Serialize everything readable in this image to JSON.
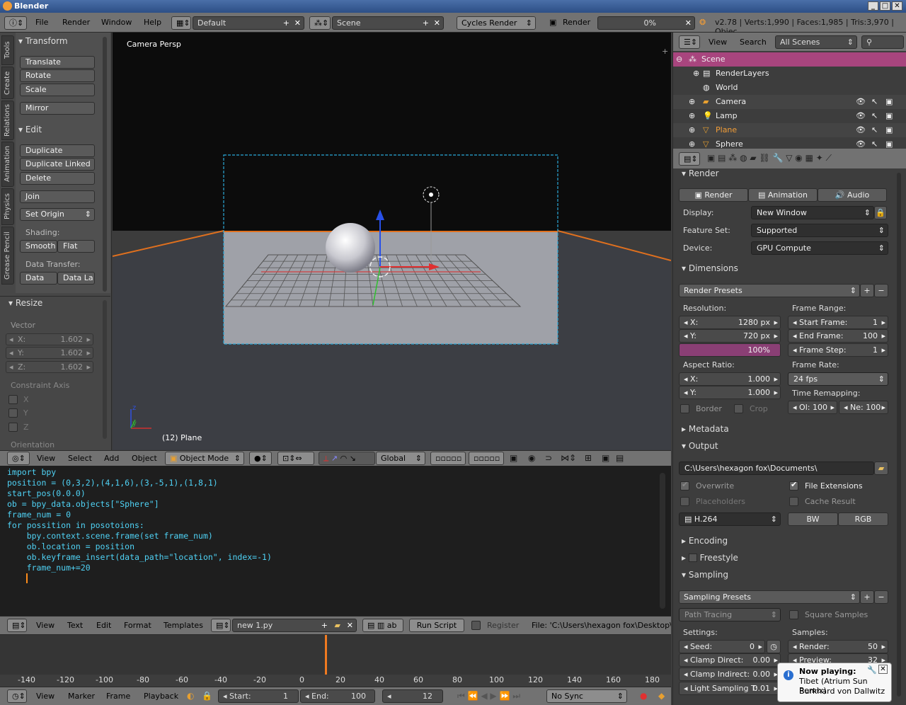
{
  "window": {
    "title": "Blender"
  },
  "info_header": {
    "menus": [
      "File",
      "Render",
      "Window",
      "Help"
    ],
    "layout": "Default",
    "scene": "Scene",
    "engine": "Cycles Render",
    "render_label": "Render",
    "progress": "0%",
    "stats": "v2.78 | Verts:1,990 | Faces:1,985 | Tris:3,970 | Objec"
  },
  "toolshelf": {
    "tabs": [
      "Tools",
      "Create",
      "Relations",
      "Animation",
      "Physics",
      "Grease Pencil"
    ],
    "transform_title": "Transform",
    "translate": "Translate",
    "rotate": "Rotate",
    "scale": "Scale",
    "mirror": "Mirror",
    "edit_title": "Edit",
    "duplicate": "Duplicate",
    "duplicate_linked": "Duplicate Linked",
    "delete": "Delete",
    "join": "Join",
    "set_origin": "Set Origin",
    "shading_label": "Shading:",
    "smooth": "Smooth",
    "flat": "Flat",
    "data_transfer_label": "Data Transfer:",
    "data": "Data",
    "data_la": "Data La",
    "resize_title": "Resize",
    "vector_label": "Vector",
    "vx": "X:",
    "vy": "Y:",
    "vz": "Z:",
    "vx_val": "1.602",
    "vy_val": "1.602",
    "vz_val": "1.602",
    "constraint_label": "Constraint Axis",
    "cx": "X",
    "cy": "Y",
    "cz": "Z",
    "orientation_label": "Orientation"
  },
  "viewport": {
    "view_label": "Camera Persp",
    "object_label": "(12) Plane",
    "axis_z": "z",
    "axis_y": "y"
  },
  "view_header": {
    "menus": [
      "View",
      "Select",
      "Add",
      "Object"
    ],
    "mode": "Object Mode",
    "orientation": "Global"
  },
  "text_editor": {
    "lines": [
      "import bpy",
      "position = (0,3,2),(4,1,6),(3,-5,1),(1,8,1)",
      "start_pos(0.0.0)",
      "ob = bpy_data.objects[\"Sphere\"]",
      "frame_num = 0",
      "for possition in posotoions:",
      "    bpy.context.scene.frame(set frame_num)",
      "    ob.location = position",
      "    ob.keyframe_insert(data_path=\"location\", index=-1)",
      "    frame_num+=20"
    ]
  },
  "text_header": {
    "menus": [
      "View",
      "Text",
      "Edit",
      "Format",
      "Templates"
    ],
    "file": "new 1.py",
    "run_script": "Run Script",
    "register": "Register",
    "path": "File: 'C:\\Users\\hexagon fox\\Desktop\\n"
  },
  "timeline": {
    "ticks": [
      "-140",
      "-120",
      "-100",
      "-80",
      "-60",
      "-40",
      "-20",
      "0",
      "20",
      "40",
      "60",
      "80",
      "100",
      "120",
      "140",
      "160",
      "180"
    ]
  },
  "timeline_header": {
    "menus": [
      "View",
      "Marker",
      "Frame",
      "Playback"
    ],
    "start_label": "Start:",
    "start": "1",
    "end_label": "End:",
    "end": "100",
    "current": "12",
    "sync": "No Sync"
  },
  "outliner": {
    "menus": [
      "View",
      "Search"
    ],
    "filter": "All Scenes",
    "rows": [
      {
        "name": "Scene"
      },
      {
        "name": "RenderLayers"
      },
      {
        "name": "World"
      },
      {
        "name": "Camera"
      },
      {
        "name": "Lamp"
      },
      {
        "name": "Plane"
      },
      {
        "name": "Sphere"
      }
    ]
  },
  "properties": {
    "render_title": "Render",
    "render_btn": "Render",
    "animation_btn": "Animation",
    "audio_btn": "Audio",
    "display_label": "Display:",
    "display": "New Window",
    "feature_label": "Feature Set:",
    "feature": "Supported",
    "device_label": "Device:",
    "device": "GPU Compute",
    "dimensions_title": "Dimensions",
    "render_presets": "Render Presets",
    "resolution_label": "Resolution:",
    "res_x": "X:",
    "res_x_val": "1280 px",
    "res_y": "Y:",
    "res_y_val": "720 px",
    "res_pct": "100%",
    "frame_range_label": "Frame Range:",
    "start_frame": "Start Frame:",
    "start_frame_val": "1",
    "end_frame": "End Frame:",
    "end_frame_val": "100",
    "frame_step": "Frame Step:",
    "frame_step_val": "1",
    "aspect_label": "Aspect Ratio:",
    "asp_x": "X:",
    "asp_x_val": "1.000",
    "asp_y": "Y:",
    "asp_y_val": "1.000",
    "frame_rate_label": "Frame Rate:",
    "frame_rate": "24 fps",
    "time_remap_label": "Time Remapping:",
    "old": "Ol: 100",
    "new": "Ne: 100",
    "border": "Border",
    "crop": "Crop",
    "metadata_title": "Metadata",
    "output_title": "Output",
    "output_path": "C:\\Users\\hexagon fox\\Documents\\",
    "overwrite": "Overwrite",
    "file_ext": "File Extensions",
    "placeholders": "Placeholders",
    "cache_result": "Cache Result",
    "format": "H.264",
    "bw": "BW",
    "rgb": "RGB",
    "encoding_title": "Encoding",
    "freestyle_title": "Freestyle",
    "sampling_title": "Sampling",
    "sampling_presets": "Sampling Presets",
    "path_tracing": "Path Tracing",
    "square_samples": "Square Samples",
    "settings_label": "Settings:",
    "samples_label": "Samples:",
    "seed": "Seed:",
    "seed_val": "0",
    "render_samples": "Render:",
    "render_samples_val": "50",
    "clamp_direct": "Clamp Direct:",
    "clamp_direct_val": "0.00",
    "preview": "Preview:",
    "preview_val": "32",
    "clamp_indirect": "Clamp Indirect:",
    "clamp_indirect_val": "0.00",
    "light_sampling": "Light Sampling T:",
    "light_sampling_val": "0.01"
  },
  "notification": {
    "title": "Now playing:",
    "line1": "Tibet (Atrium Sun Remix)",
    "line2": "Burkhard von Dallwitz"
  },
  "colors": {
    "accent": "#f29d37",
    "selected_row": "#a8457e",
    "progress_fill": "#8a3f75",
    "plane_text": "#f29d37",
    "code": "#4fd2f5"
  }
}
